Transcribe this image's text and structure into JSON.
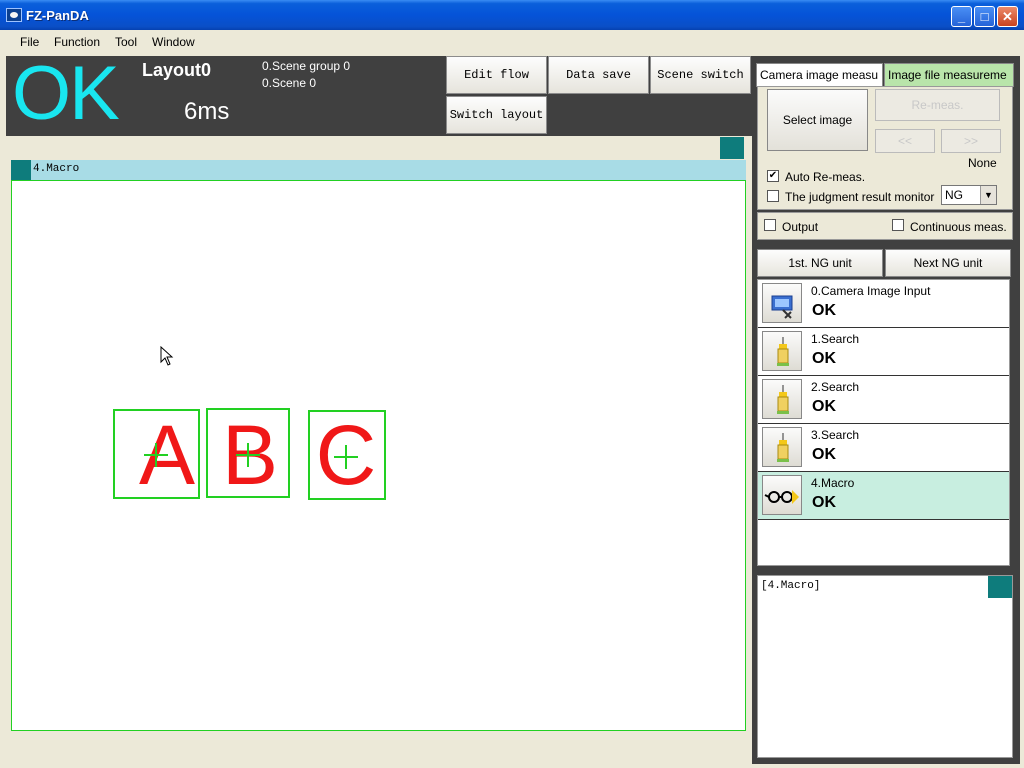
{
  "window": {
    "title": "FZ-PanDA"
  },
  "menu": {
    "items": [
      "File",
      "Function",
      "Tool",
      "Window"
    ]
  },
  "status": {
    "judgement": "OK",
    "layout": "Layout0",
    "time": "6ms",
    "scene_group": "0.Scene group 0",
    "scene": "0.Scene 0",
    "judgement_color": "#19E6F0"
  },
  "toolbar": {
    "edit_flow": "Edit flow",
    "data_save": "Data save",
    "scene_switch": "Scene switch",
    "switch_layout": "Switch layout"
  },
  "image_window": {
    "tab_label": "4.Macro",
    "glyphs": [
      "A",
      "B",
      "C"
    ],
    "glyph_color": "#F01818",
    "box_color": "#22D022"
  },
  "measure_tabs": {
    "camera": "Camera image measu",
    "file": "Image file measureme"
  },
  "measure_panel": {
    "select_image": "Select image",
    "re_meas": "Re-meas.",
    "prev": "<<",
    "next": ">>",
    "none_label": "None",
    "auto_re_meas": "Auto Re-meas.",
    "auto_re_meas_checked": true,
    "judgment_monitor": "The judgment result monitor",
    "judgment_monitor_checked": false,
    "judgment_select": "NG",
    "output": "Output",
    "continuous": "Continuous meas."
  },
  "ng_buttons": {
    "first": "1st. NG unit",
    "next": "Next NG unit"
  },
  "flow": [
    {
      "name": "0.Camera Image Input",
      "result": "OK",
      "icon": "camera-input-icon"
    },
    {
      "name": "1.Search",
      "result": "OK",
      "icon": "search-unit-icon"
    },
    {
      "name": "2.Search",
      "result": "OK",
      "icon": "search-unit-icon"
    },
    {
      "name": "3.Search",
      "result": "OK",
      "icon": "search-unit-icon"
    },
    {
      "name": "4.Macro",
      "result": "OK",
      "icon": "macro-glasses-icon"
    }
  ],
  "detail": {
    "label": "[4.Macro]"
  }
}
